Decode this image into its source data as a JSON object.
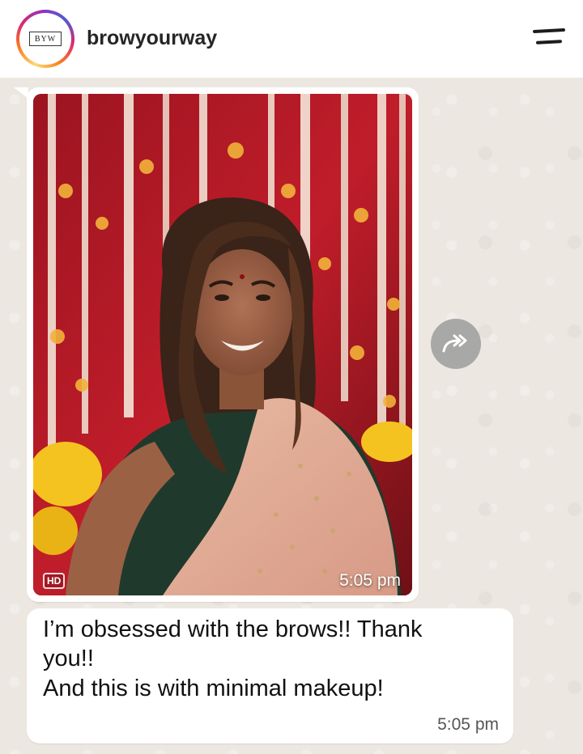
{
  "header": {
    "avatar_logo_text": "BYW",
    "username": "browyourway",
    "menu_icon": "hamburger-menu-icon"
  },
  "chat": {
    "image_message": {
      "hd_label": "HD",
      "time": "5:05 pm"
    },
    "forward_icon": "forward-icon",
    "text_message": {
      "lines": [
        "I’m obsessed with the brows!! Thank",
        "you!!",
        "And this is with minimal makeup!"
      ],
      "time": "5:05 pm"
    }
  },
  "colors": {
    "chat_background": "#ece7e1",
    "bubble": "#ffffff",
    "forward_button": "#a8a8a6"
  }
}
